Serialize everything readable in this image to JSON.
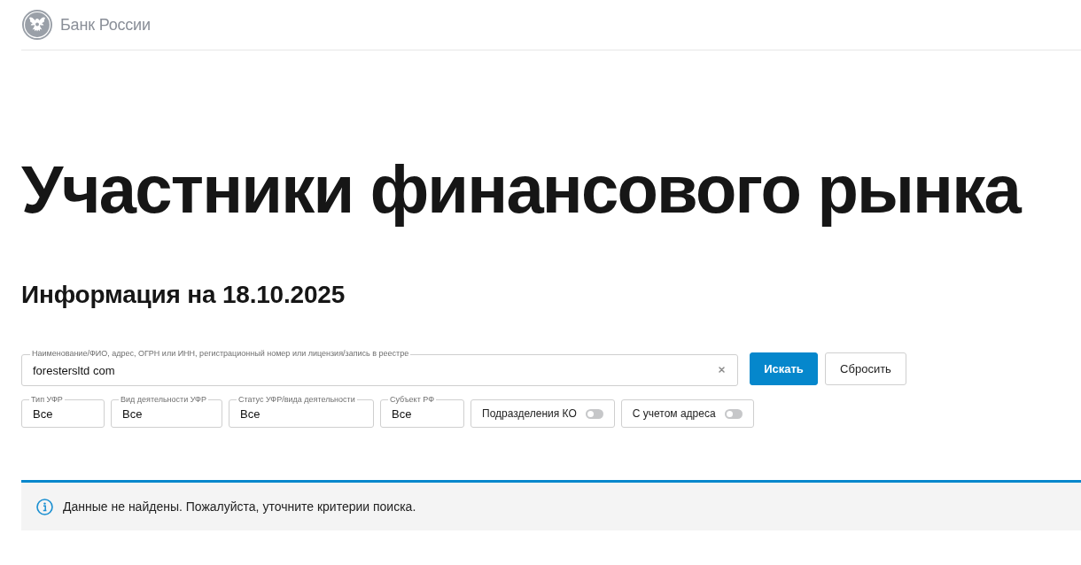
{
  "header": {
    "brand": "Банк России"
  },
  "page_title": "Участники финансового рынка",
  "info_date": "Информация на 18.10.2025",
  "search": {
    "label": "Наименование/ФИО, адрес, ОГРН или ИНН, регистрационный номер или лицензия/запись в реестре",
    "value": "forestersltd com",
    "buttons": [
      {
        "label": "Искать",
        "kind": "primary"
      },
      {
        "label": "Сбросить",
        "kind": "secondary"
      }
    ]
  },
  "filters": [
    {
      "kind": "dropdown",
      "label": "Тип УФР",
      "value": "Все"
    },
    {
      "kind": "dropdown",
      "label": "Вид деятельности УФР",
      "value": "Все"
    },
    {
      "kind": "dropdown",
      "label": "Статус УФР/вида деятельности",
      "value": "Все"
    },
    {
      "kind": "dropdown",
      "label": "Субъект РФ",
      "value": "Все"
    },
    {
      "kind": "toggle",
      "label": "Подразделения КО",
      "on": false
    },
    {
      "kind": "toggle",
      "label": "С учетом адреса",
      "on": false
    }
  ],
  "alert": {
    "kind": "info",
    "message": "Данные не найдены. Пожалуйста, уточните критерии поиска."
  }
}
